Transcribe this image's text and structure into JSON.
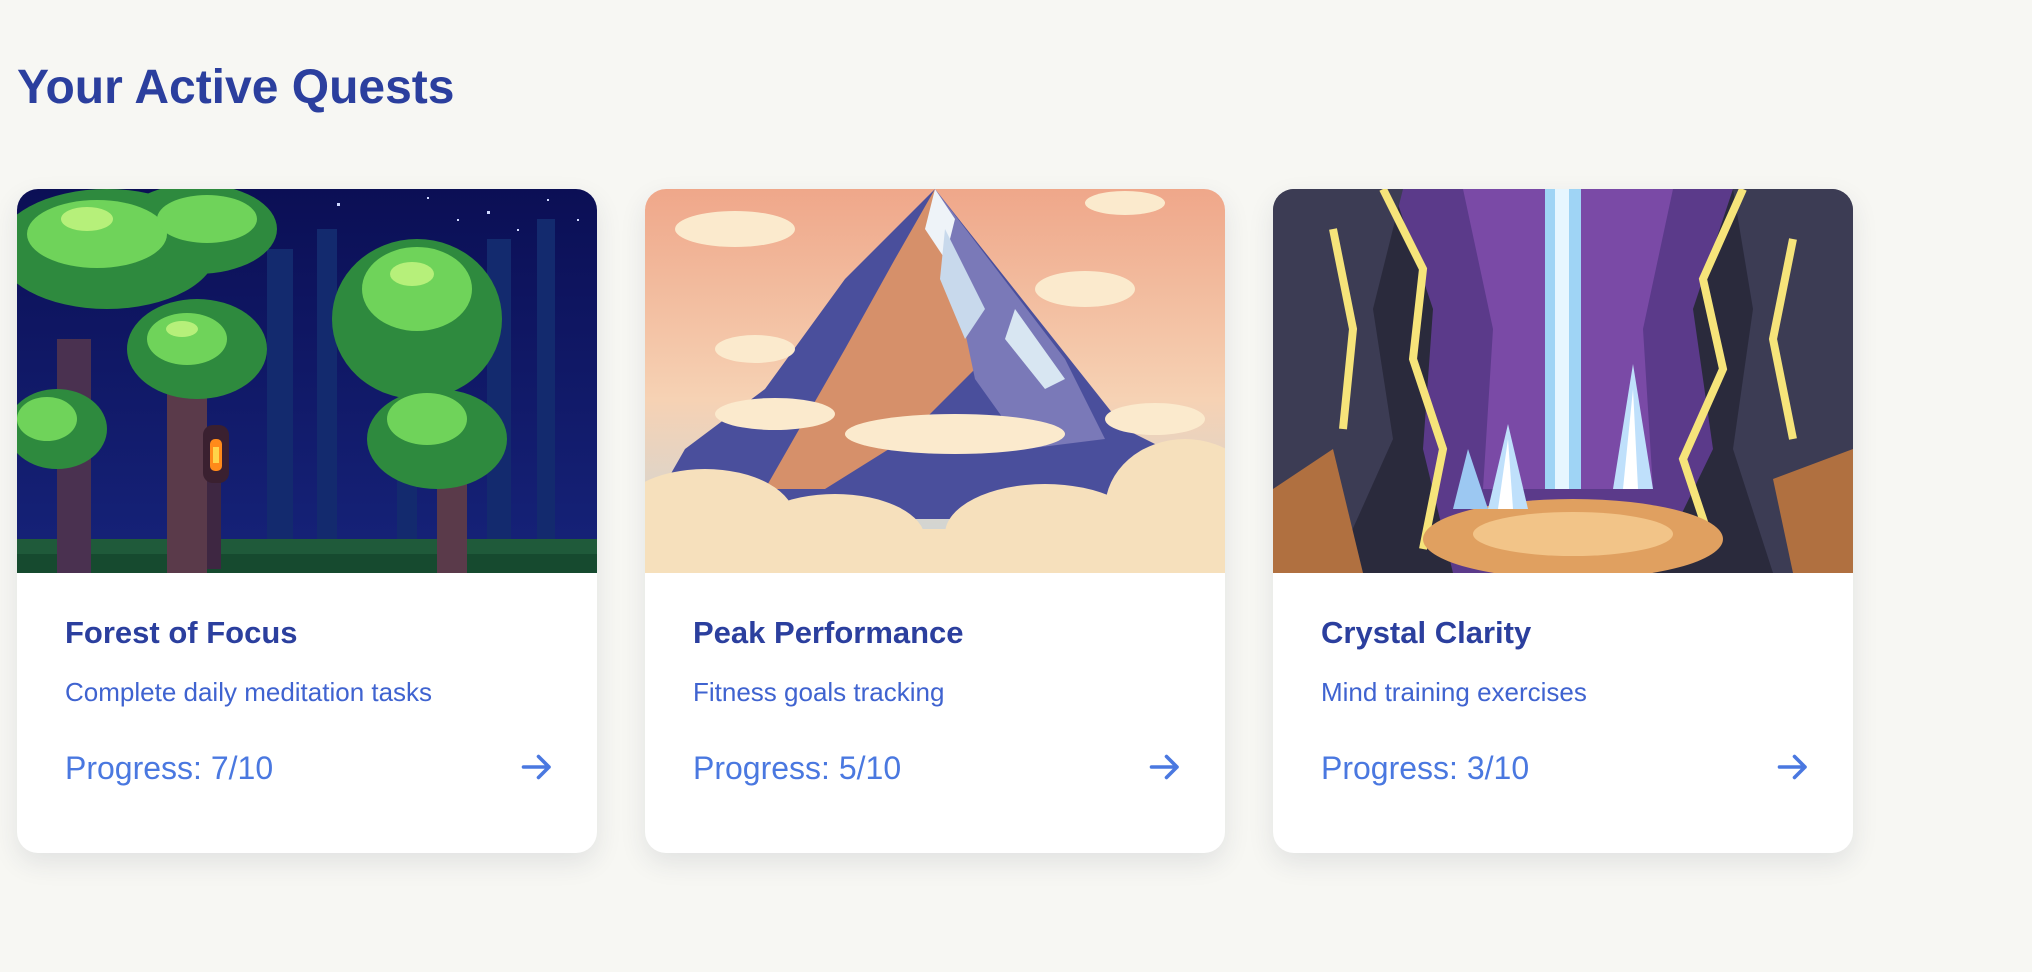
{
  "page": {
    "title": "Your Active Quests"
  },
  "colors": {
    "background": "#f7f7f3",
    "heading": "#2b3f9e",
    "description": "#3f63d0",
    "progress": "#4a78e0",
    "card": "#ffffff"
  },
  "quests": [
    {
      "title": "Forest of Focus",
      "description": "Complete daily meditation tasks",
      "progress_label": "Progress: 7/10",
      "progress_value": 0.7,
      "image": "pixel-art-night-forest-with-lantern",
      "action_icon": "arrow-right-icon"
    },
    {
      "title": "Peak Performance",
      "description": "Fitness goals tracking",
      "progress_label": "Progress: 5/10",
      "progress_value": 0.5,
      "image": "pixel-art-snowy-mountain-above-clouds",
      "action_icon": "arrow-right-icon"
    },
    {
      "title": "Crystal Clarity",
      "description": "Mind training exercises",
      "progress_label": "Progress: 3/10",
      "progress_value": 0.3,
      "image": "pixel-art-crystal-cave-with-waterfall",
      "action_icon": "arrow-right-icon"
    }
  ]
}
